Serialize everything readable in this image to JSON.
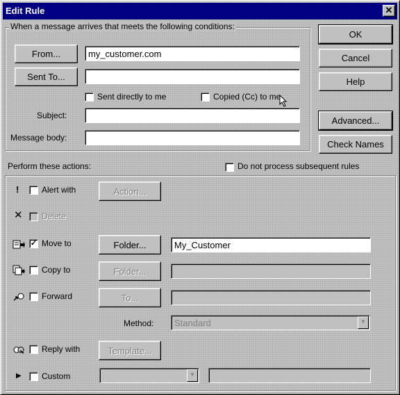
{
  "window": {
    "title": "Edit Rule",
    "close_glyph": "✕"
  },
  "conditions": {
    "group_title": "When a message arrives that meets the following conditions:",
    "from_button": "From...",
    "from_value": "my_customer.com",
    "sentto_button": "Sent To...",
    "sentto_value": "",
    "sent_directly_label": "Sent directly to me",
    "copied_label": "Copied (Cc) to me",
    "subject_label": "Subject:",
    "subject_value": "",
    "body_label": "Message body:",
    "body_value": ""
  },
  "side_buttons": {
    "ok": "OK",
    "cancel": "Cancel",
    "help": "Help",
    "advanced": "Advanced...",
    "check_names": "Check Names"
  },
  "actions": {
    "title": "Perform these actions:",
    "do_not_process_label": "Do not process subsequent rules",
    "alert": {
      "label": "Alert with",
      "button": "Action...",
      "checked": false,
      "icon": "exclamation-icon"
    },
    "delete": {
      "label": "Delete",
      "checked": false,
      "icon": "delete-x-icon"
    },
    "move": {
      "label": "Move to",
      "button": "Folder...",
      "value": "My_Customer",
      "checked": true,
      "icon": "move-folder-icon"
    },
    "copy": {
      "label": "Copy to",
      "button": "Folder...",
      "value": "",
      "checked": false,
      "icon": "copy-folder-icon"
    },
    "forward": {
      "label": "Forward",
      "button": "To...",
      "value": "",
      "checked": false,
      "icon": "forward-icon"
    },
    "method": {
      "label": "Method:",
      "value": "Standard"
    },
    "reply": {
      "label": "Reply with",
      "button": "Template...",
      "checked": false,
      "icon": "reply-icon"
    },
    "custom": {
      "label": "Custom",
      "value": "",
      "checked": false,
      "icon": "triangle-right-icon"
    }
  }
}
